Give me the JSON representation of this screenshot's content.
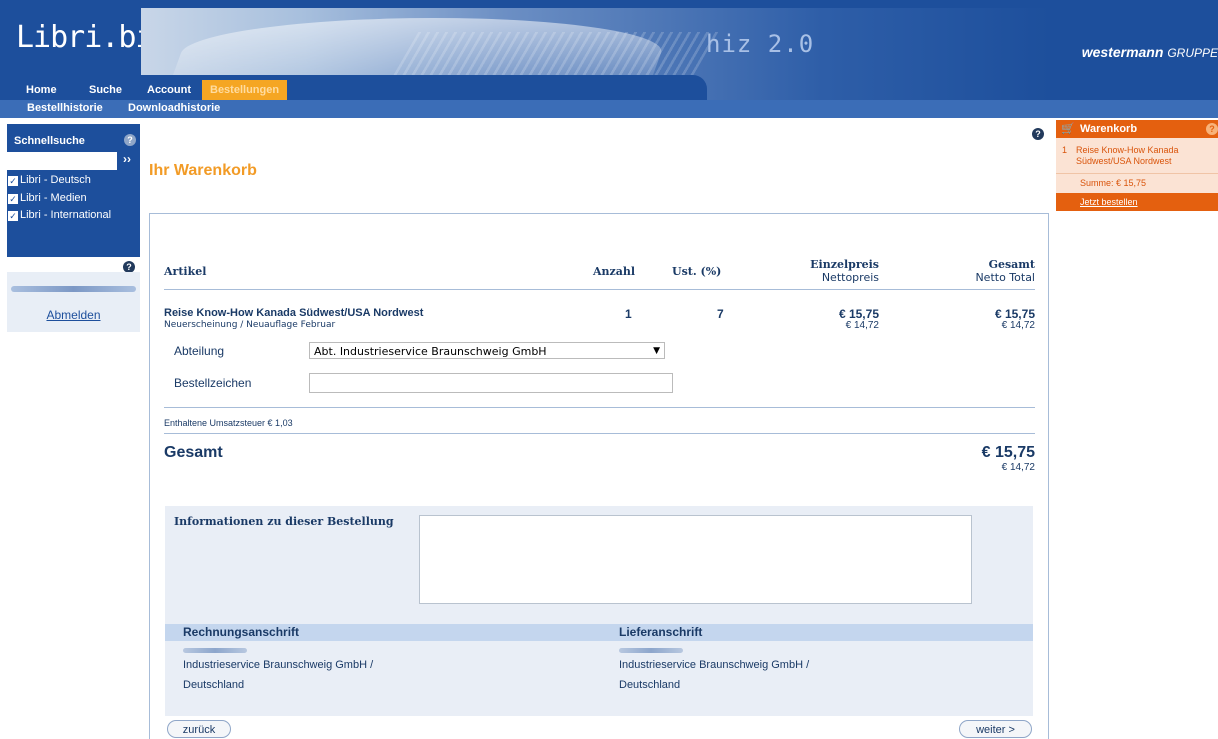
{
  "header": {
    "logo": "Libri.biz",
    "banner_text": "hiz 2.0",
    "brand": "westermann",
    "brand_suffix": "GRUPPE"
  },
  "nav": {
    "tabs": [
      {
        "label": "Home"
      },
      {
        "label": "Suche"
      },
      {
        "label": "Account"
      },
      {
        "label": "Bestellungen",
        "active": true
      }
    ],
    "subtabs": [
      {
        "label": "Bestellhistorie"
      },
      {
        "label": "Downloadhistorie"
      }
    ]
  },
  "sidebar": {
    "quicksearch_title": "Schnellsuche",
    "search_value": "",
    "go_label": "››",
    "checkboxes": [
      {
        "label": "Libri - Deutsch",
        "checked": true
      },
      {
        "label": "Libri - Medien",
        "checked": true
      },
      {
        "label": "Libri - International",
        "checked": true
      }
    ],
    "logout_label": "Abmelden"
  },
  "main": {
    "title": "Ihr Warenkorb",
    "columns": {
      "artikel": "Artikel",
      "anzahl": "Anzahl",
      "ust": "Ust. (%)",
      "einzelpreis": "Einzelpreis",
      "einzelpreis_sub": "Nettopreis",
      "gesamt": "Gesamt",
      "gesamt_sub": "Netto Total"
    },
    "item": {
      "title": "Reise Know-How Kanada Südwest/USA Nordwest",
      "subtitle": "Neuerscheinung / Neuauflage Februar",
      "quantity": "1",
      "vat": "7",
      "unit_price": "€ 15,75",
      "unit_net": "€ 14,72",
      "total_price": "€ 15,75",
      "total_net": "€ 14,72"
    },
    "department_label": "Abteilung",
    "department_value": "Abt. Industrieservice Braunschweig GmbH",
    "order_ref_label": "Bestellzeichen",
    "order_ref_value": "",
    "vat_note": "Enthaltene Umsatzsteuer € 1,03",
    "total_label": "Gesamt",
    "total_value": "€ 15,75",
    "total_net": "€ 14,72",
    "info_label": "Informationen zu dieser Bestellung",
    "info_value": "",
    "billing_header": "Rechnungsanschrift",
    "shipping_header": "Lieferanschrift",
    "billing_line1": "Industrieservice Braunschweig GmbH /",
    "billing_line2": "Deutschland",
    "shipping_line1": "Industrieservice Braunschweig GmbH /",
    "shipping_line2": "Deutschland",
    "back_label": "zurück",
    "next_label": "weiter >"
  },
  "cart": {
    "title": "Warenkorb",
    "item_qty": "1",
    "item_title": "Reise Know-How Kanada Südwest/USA Nordwest",
    "sum": "Summe: € 15,75",
    "order_now": "Jetzt bestellen"
  },
  "colors": {
    "nav_blue": "#1d4f9c",
    "accent_orange": "#f29b26",
    "cart_orange": "#e4600f"
  }
}
